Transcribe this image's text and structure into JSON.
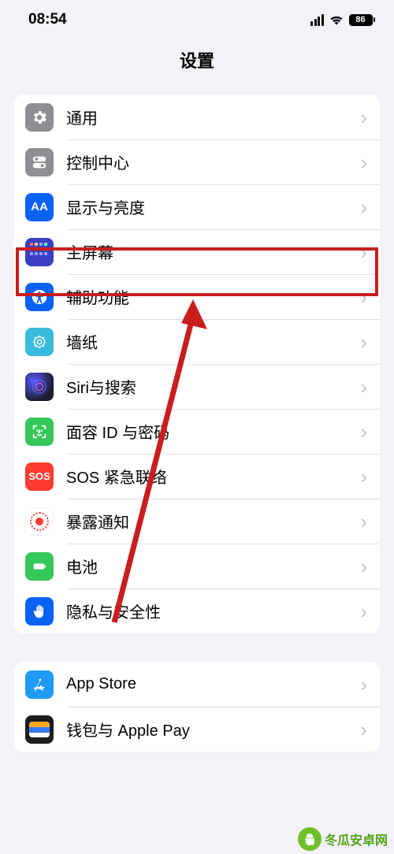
{
  "status": {
    "time": "08:54",
    "battery": "86"
  },
  "title": "设置",
  "groups": [
    {
      "rows": [
        {
          "key": "general",
          "label": "通用"
        },
        {
          "key": "control",
          "label": "控制中心"
        },
        {
          "key": "display",
          "label": "显示与亮度",
          "icon_text": "AA"
        },
        {
          "key": "home",
          "label": "主屏幕",
          "highlight": true
        },
        {
          "key": "access",
          "label": "辅助功能"
        },
        {
          "key": "wallpaper",
          "label": "墙纸"
        },
        {
          "key": "siri",
          "label": "Siri与搜索"
        },
        {
          "key": "faceid",
          "label": "面容 ID 与密码"
        },
        {
          "key": "sos",
          "label": "SOS 紧急联络",
          "icon_text": "SOS"
        },
        {
          "key": "exposure",
          "label": "暴露通知"
        },
        {
          "key": "battery",
          "label": "电池"
        },
        {
          "key": "privacy",
          "label": "隐私与安全性"
        }
      ]
    },
    {
      "rows": [
        {
          "key": "appstore",
          "label": "App Store"
        },
        {
          "key": "wallet",
          "label": "钱包与 Apple Pay"
        }
      ]
    }
  ],
  "watermark": "冬瓜安卓网"
}
